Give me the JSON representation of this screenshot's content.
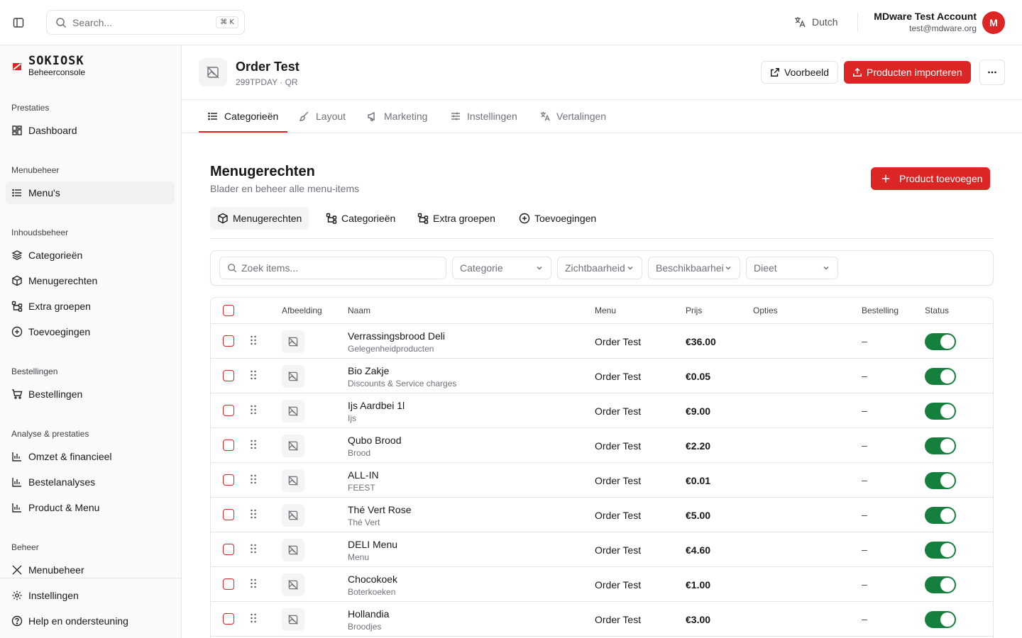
{
  "topbar": {
    "search_placeholder": "Search...",
    "search_shortcut": "⌘ K",
    "language": "Dutch",
    "account_name": "MDware Test Account",
    "account_email": "test@mdware.org",
    "avatar_initial": "M"
  },
  "sidebar": {
    "logo_text": "SOKIOSK",
    "logo_sub": "Beheerconsole",
    "sections": {
      "prestaties": "Prestaties",
      "menubeheer": "Menubeheer",
      "inhoudsbeheer": "Inhoudsbeheer",
      "bestellingen": "Bestellingen",
      "analyse": "Analyse & prestaties",
      "beheer": "Beheer"
    },
    "items": {
      "dashboard": "Dashboard",
      "menus": "Menu's",
      "categorieen": "Categorieën",
      "menugerechten": "Menugerechten",
      "extra_groepen": "Extra groepen",
      "toevoegingen": "Toevoegingen",
      "bestellingen": "Bestellingen",
      "omzet": "Omzet & financieel",
      "bestelanalyses": "Bestelanalyses",
      "product_menu": "Product & Menu",
      "menubeheer": "Menubeheer",
      "instellingen": "Instellingen",
      "help": "Help en ondersteuning"
    }
  },
  "header": {
    "title": "Order Test",
    "subtitle": "299TPDAY · QR",
    "preview_label": "Voorbeeld",
    "import_label": "Producten importeren"
  },
  "tabs": {
    "categorieen": "Categorieën",
    "layout": "Layout",
    "marketing": "Marketing",
    "instellingen": "Instellingen",
    "vertalingen": "Vertalingen"
  },
  "section": {
    "title": "Menugerechten",
    "subtitle": "Blader en beheer alle menu-items",
    "add_label": "Product toevoegen"
  },
  "subtabs": {
    "menugerechten": "Menugerechten",
    "categorieen": "Categorieën",
    "extra_groepen": "Extra groepen",
    "toevoegingen": "Toevoegingen"
  },
  "filters": {
    "search_placeholder": "Zoek items...",
    "categorie": "Categorie",
    "zichtbaarheid": "Zichtbaarheid",
    "beschikbaarheid": "Beschikbaarheid",
    "dieet": "Dieet"
  },
  "table": {
    "headers": {
      "afbeelding": "Afbeelding",
      "naam": "Naam",
      "menu": "Menu",
      "prijs": "Prijs",
      "opties": "Opties",
      "bestelling": "Bestelling",
      "status": "Status"
    },
    "rows": [
      {
        "name": "Verrassingsbrood Deli",
        "category": "Gelegenheidproducten",
        "menu": "Order Test",
        "price": "€36.00",
        "order": "–",
        "active": true
      },
      {
        "name": "Bio Zakje",
        "category": "Discounts & Service charges",
        "menu": "Order Test",
        "price": "€0.05",
        "order": "–",
        "active": true
      },
      {
        "name": "Ijs Aardbei 1l",
        "category": "Ijs",
        "menu": "Order Test",
        "price": "€9.00",
        "order": "–",
        "active": true
      },
      {
        "name": "Qubo Brood",
        "category": "Brood",
        "menu": "Order Test",
        "price": "€2.20",
        "order": "–",
        "active": true
      },
      {
        "name": "ALL-IN",
        "category": "FEEST",
        "menu": "Order Test",
        "price": "€0.01",
        "order": "–",
        "active": true
      },
      {
        "name": "Thé Vert Rose",
        "category": "Thé Vert",
        "menu": "Order Test",
        "price": "€5.00",
        "order": "–",
        "active": true
      },
      {
        "name": "DELI Menu",
        "category": "Menu",
        "menu": "Order Test",
        "price": "€4.60",
        "order": "–",
        "active": true
      },
      {
        "name": "Chocokoek",
        "category": "Boterkoeken",
        "menu": "Order Test",
        "price": "€1.00",
        "order": "–",
        "active": true
      },
      {
        "name": "Hollandia",
        "category": "Broodjes",
        "menu": "Order Test",
        "price": "€3.00",
        "order": "–",
        "active": true
      }
    ]
  },
  "colors": {
    "accent": "#dc2626",
    "toggle_on": "#15803d"
  }
}
